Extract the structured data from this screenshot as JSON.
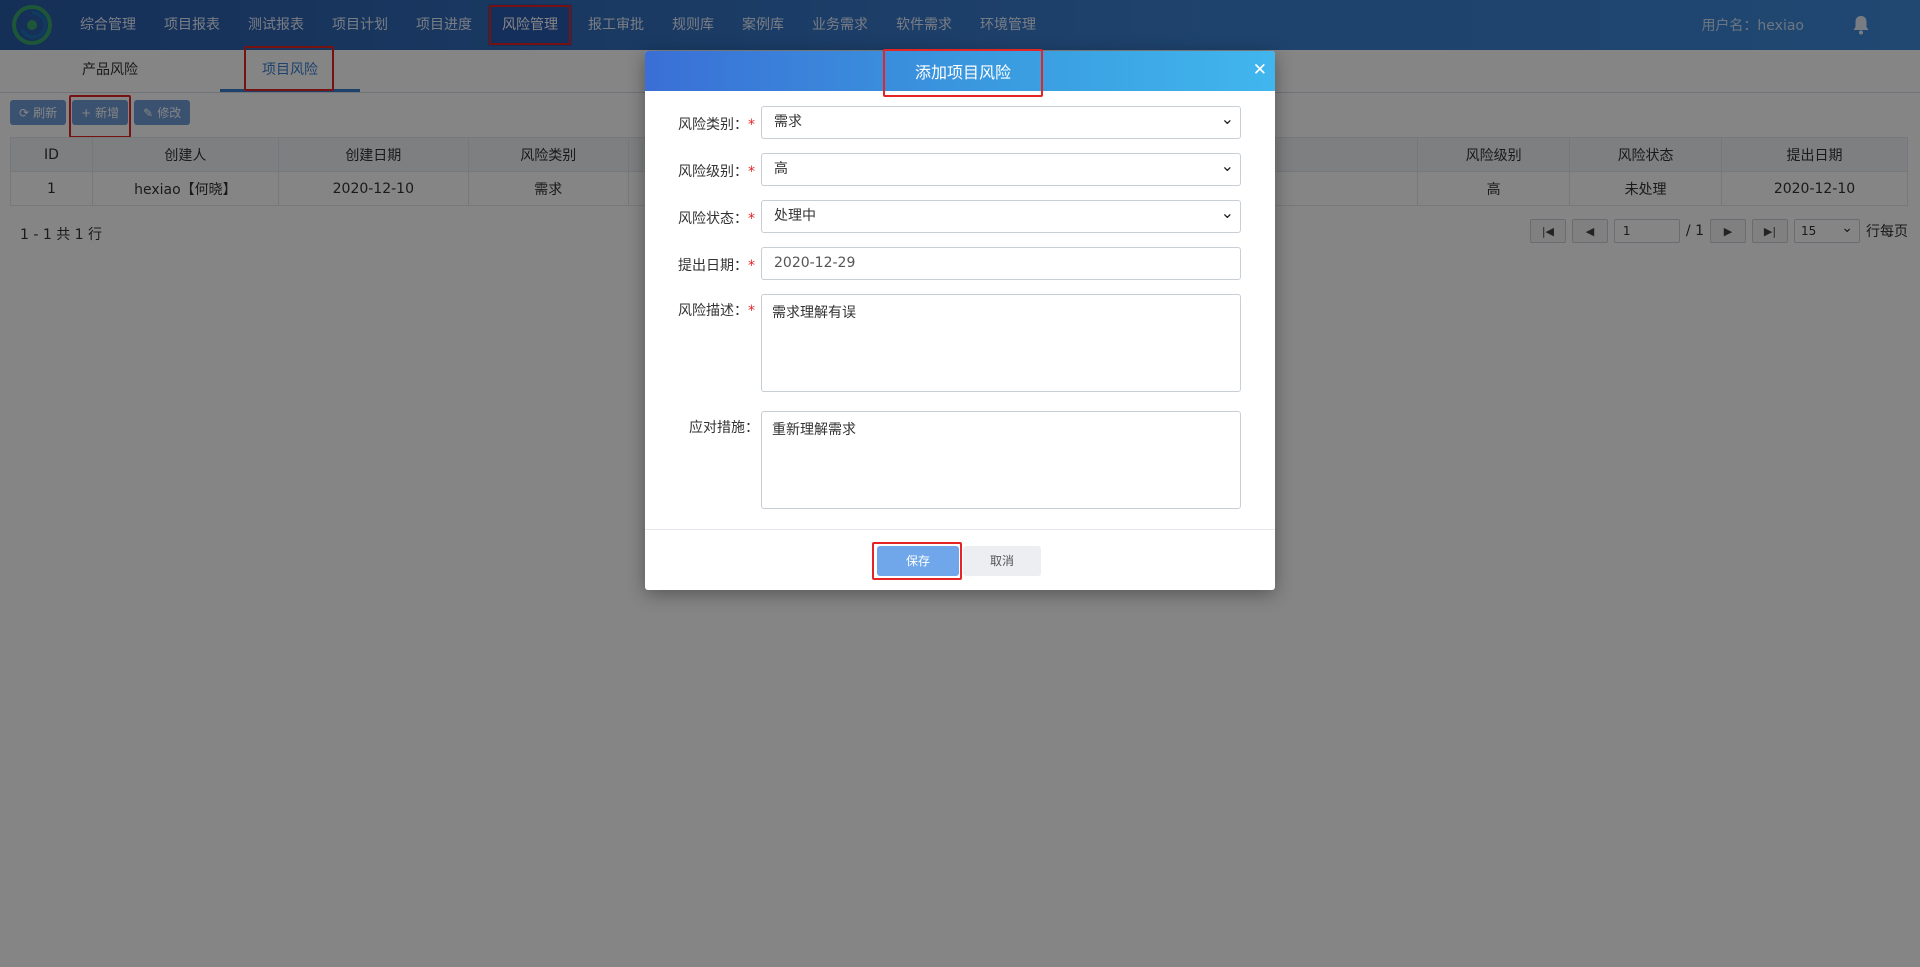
{
  "nav": {
    "items": [
      "综合管理",
      "项目报表",
      "测试报表",
      "项目计划",
      "项目进度",
      "风险管理",
      "报工审批",
      "规则库",
      "案例库",
      "业务需求",
      "软件需求",
      "环境管理"
    ],
    "active_index": 5,
    "user_label": "用户名：hexiao"
  },
  "subtabs": {
    "items": [
      "产品风险",
      "项目风险"
    ],
    "active_index": 1
  },
  "toolbar": {
    "refresh": "刷新",
    "add": "新增",
    "edit": "修改"
  },
  "table": {
    "columns_left": [
      "ID",
      "创建人",
      "创建日期",
      "风险类别"
    ],
    "columns_right": [
      "风险级别",
      "风险状态",
      "提出日期"
    ],
    "rows": [
      {
        "left": [
          "1",
          "hexiao【何晓】",
          "2020-12-10",
          "需求"
        ],
        "right": [
          "高",
          "未处理",
          "2020-12-10"
        ]
      }
    ]
  },
  "footer": {
    "info": "1 - 1 共 1 行",
    "page_input": "1",
    "page_total": "/ 1",
    "page_size": "15",
    "per_page_label": "行每页"
  },
  "modal": {
    "title": "添加项目风险",
    "fields": {
      "category": {
        "label": "风险类别：",
        "value": "需求",
        "required": true
      },
      "level": {
        "label": "风险级别：",
        "value": "高",
        "required": true
      },
      "status": {
        "label": "风险状态：",
        "value": "处理中",
        "required": true
      },
      "date": {
        "label": "提出日期：",
        "value": "2020-12-29",
        "required": true
      },
      "description": {
        "label": "风险描述：",
        "value": "需求理解有误",
        "required": true
      },
      "measure": {
        "label": "应对措施：",
        "value": "重新理解需求",
        "required": false
      }
    },
    "save_label": "保存",
    "cancel_label": "取消"
  },
  "colors": {
    "nav_start": "#2a5ca8",
    "nav_end": "#3e8ad9",
    "highlight_box": "#e52424",
    "primary_button": "#6fa7ea"
  },
  "icons": {
    "refresh": "refresh-icon",
    "add": "plus-icon",
    "edit": "edit-icon",
    "close": "close-icon",
    "bell": "bell-icon"
  }
}
